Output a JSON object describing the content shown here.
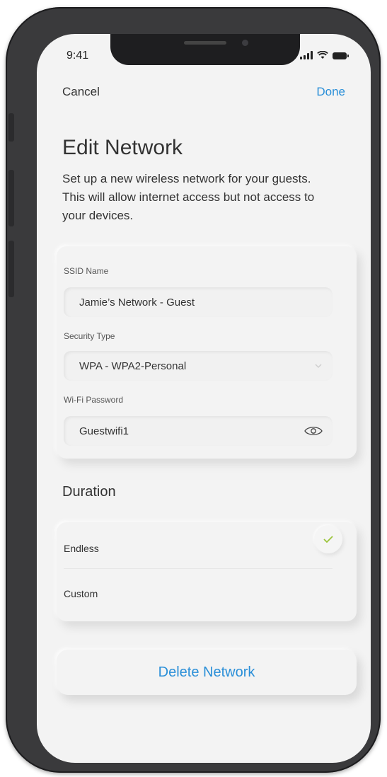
{
  "status_bar": {
    "time": "9:41"
  },
  "nav": {
    "cancel_label": "Cancel",
    "done_label": "Done"
  },
  "page": {
    "title": "Edit Network",
    "description": "Set up a new wireless network for your guests. This will allow internet access but not access to your devices."
  },
  "form": {
    "ssid_label": "SSID Name",
    "ssid_value": "Jamie’s Network - Guest",
    "security_label": "Security Type",
    "security_value": "WPA - WPA2-Personal",
    "password_label": "Wi-Fi Password",
    "password_value": "Guestwifi1"
  },
  "duration": {
    "title": "Duration",
    "options": [
      {
        "label": "Endless",
        "selected": true
      },
      {
        "label": "Custom",
        "selected": false
      }
    ]
  },
  "actions": {
    "delete_label": "Delete Network"
  },
  "colors": {
    "accent": "#2a8fd8",
    "check": "#9bc43a",
    "background": "#f3f3f3"
  }
}
